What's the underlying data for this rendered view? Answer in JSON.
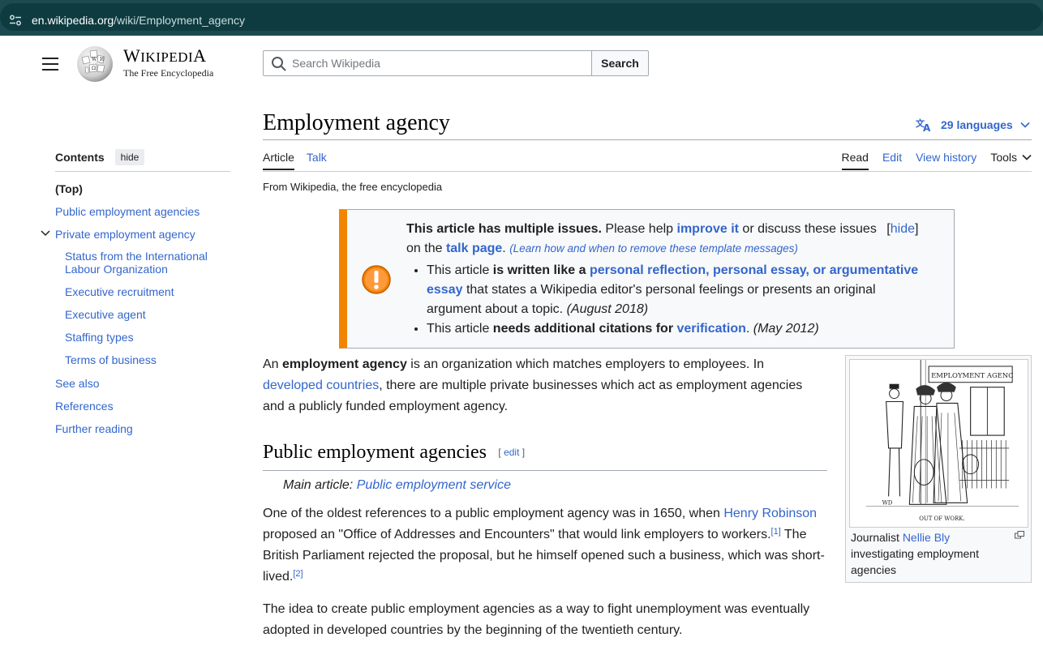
{
  "browser": {
    "url_host": "en.wikipedia.org",
    "url_path": "/wiki/Employment_agency"
  },
  "header": {
    "wordmark_first": "W",
    "wordmark_rest": "IKIPEDI",
    "wordmark_last": "A",
    "tagline": "The Free Encyclopedia",
    "search_placeholder": "Search Wikipedia",
    "search_button": "Search"
  },
  "toc": {
    "title": "Contents",
    "hide_label": "hide",
    "items": [
      {
        "label": "(Top)"
      },
      {
        "label": "Public employment agencies"
      },
      {
        "label": "Private employment agency"
      },
      {
        "label": "Status from the International Labour Organization"
      },
      {
        "label": "Executive recruitment"
      },
      {
        "label": "Executive agent"
      },
      {
        "label": "Staffing types"
      },
      {
        "label": "Terms of business"
      },
      {
        "label": "See also"
      },
      {
        "label": "References"
      },
      {
        "label": "Further reading"
      }
    ]
  },
  "page": {
    "title": "Employment agency",
    "languages": "29 languages",
    "tabs_left": [
      "Article",
      "Talk"
    ],
    "tabs_right": [
      "Read",
      "Edit",
      "View history"
    ],
    "tools": "Tools",
    "from": "From Wikipedia, the free encyclopedia"
  },
  "ambox": {
    "title": "This article has multiple issues.",
    "t1": " Please help ",
    "improve": "improve it",
    "t2": " or discuss these issues",
    "hide_open": "[",
    "hide": "hide",
    "hide_close": "]",
    "t3": "on the ",
    "talk": "talk page",
    "t4": ". ",
    "learn": "(Learn how and when to remove these template messages)",
    "i1_a": "This article ",
    "i1_b": "is written like a ",
    "i1_link": "personal reflection, personal essay, or argumentative essay",
    "i1_c": " that states a Wikipedia editor's personal feelings or presents an original argument about a topic. ",
    "i1_date": "(August 2018)",
    "i2_a": "This article ",
    "i2_b": "needs additional citations for ",
    "i2_link": "verification",
    "i2_c": ". ",
    "i2_date": "(May 2012)"
  },
  "article": {
    "p1_a": "An ",
    "p1_b": "employment agency",
    "p1_c": " is an organization which matches employers to employees. In ",
    "p1_link": "developed countries",
    "p1_d": ", there are multiple private businesses which act as employment agencies and a publicly funded employment agency.",
    "h2": "Public employment agencies",
    "edit_open": "[ ",
    "edit": "edit",
    "edit_close": " ]",
    "hat_a": "Main article: ",
    "hat_link": "Public employment service",
    "p2_a": "One of the oldest references to a public employment agency was in 1650, when ",
    "p2_link": "Henry Robinson",
    "p2_b": " proposed an \"Office of Addresses and Encounters\" that would link employers to workers.",
    "ref1": "[1]",
    "p2_c": " The British Parliament rejected the proposal, but he himself opened such a business, which was short-lived.",
    "ref2": "[2]",
    "p3": "The idea to create public employment agencies as a way to fight unemployment was eventually adopted in developed countries by the beginning of the twentieth century."
  },
  "thumb": {
    "sign": "EMPLOYMENT AGENC",
    "img_caption": "OUT OF WORK.",
    "signature": "WD",
    "cap_a": "Journalist ",
    "cap_link": "Nellie Bly",
    "cap_b": " investigating employment agencies"
  }
}
